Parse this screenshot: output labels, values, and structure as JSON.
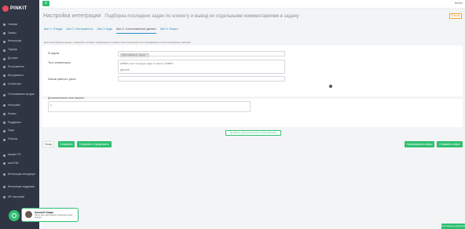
{
  "app": {
    "logo_text": "PINKIT",
    "menu_icon": "hamburger-icon",
    "user_label": "Выйти"
  },
  "sidebar": {
    "items": [
      {
        "label": "Главная",
        "icon": "home-icon"
      },
      {
        "label": "Заказы",
        "icon": "orders-icon"
      },
      {
        "label": "Интеграции",
        "icon": "integrations-icon"
      },
      {
        "label": "Тарифы",
        "icon": "tariffs-icon"
      },
      {
        "label": "Доступы",
        "icon": "access-icon"
      },
      {
        "label": "Пользователи",
        "icon": "users-icon"
      },
      {
        "label": "Инструменты",
        "icon": "tools-icon"
      },
      {
        "label": "Статистика",
        "icon": "stats-icon"
      },
      {
        "label": "Отслеживание продаж",
        "icon": "tracking-icon"
      },
      {
        "label": "Настройки",
        "icon": "settings-icon"
      },
      {
        "label": "Баланс",
        "icon": "balance-icon"
      },
      {
        "label": "Поддержка",
        "icon": "support-icon"
      },
      {
        "label": "Лиды",
        "icon": "leads-icon"
      },
      {
        "label": "Помощь",
        "icon": "help-icon"
      }
    ],
    "bottom_items": [
      {
        "label": "Аккаунт PK",
        "icon": "account-icon"
      },
      {
        "label": "amoCRM",
        "icon": "crm-icon"
      },
      {
        "label": "Интеграция инструкция",
        "icon": "doc-icon"
      },
      {
        "label": "Интеграция поддержки",
        "icon": "doc-icon"
      },
      {
        "label": "API настройки",
        "icon": "api-icon"
      }
    ]
  },
  "header": {
    "title": "Настройка интеграции",
    "subtitle": "Подборка последних задач по клиенту и вывод их отдельными комментариями в задачу",
    "help_button": "Помощь"
  },
  "tabs": [
    {
      "label": "Шаг 1: Откуда",
      "active": false
    },
    {
      "label": "Шаг 2: Инструменты",
      "active": false
    },
    {
      "label": "Шаг 3: Куда",
      "active": false
    },
    {
      "label": "Шаг 4: Сопоставление данных",
      "active": true
    },
    {
      "label": "Шаг 5: Запуск",
      "active": false
    }
  ],
  "form": {
    "hint": "Для сопоставления данных, пожалуйста, вставьте переменную из правого окна или вызовите ее в выпадающем списке необходимое значение",
    "id_label": "ID задачи",
    "id_chip": "Идентификатор задачи ×",
    "comment_label": "Текст комментария",
    "comment_lines": [
      "[ОТВЕТ] текст последних задач по клиенту [ОТВЕТ]",
      "[Дата] ID)"
    ],
    "files_label": "Массив файлов с диска",
    "files_value": "",
    "extra_label": "Дополнительные поля запроса",
    "extra_value": "[]"
  },
  "buttons": {
    "add_mapping": "Добавить дополнительное сопоставление",
    "back": "Назад",
    "save": "Сохранить",
    "save_continue": "Сохранить и продолжить",
    "form_request": "Сформировать запрос",
    "send_request": "Отправить запрос"
  },
  "chat": {
    "name": "Алексей Опара",
    "message": "Чем я могу вам помочь? Напишите ваш вопрос!"
  },
  "status_badge": "Системные уведомления"
}
